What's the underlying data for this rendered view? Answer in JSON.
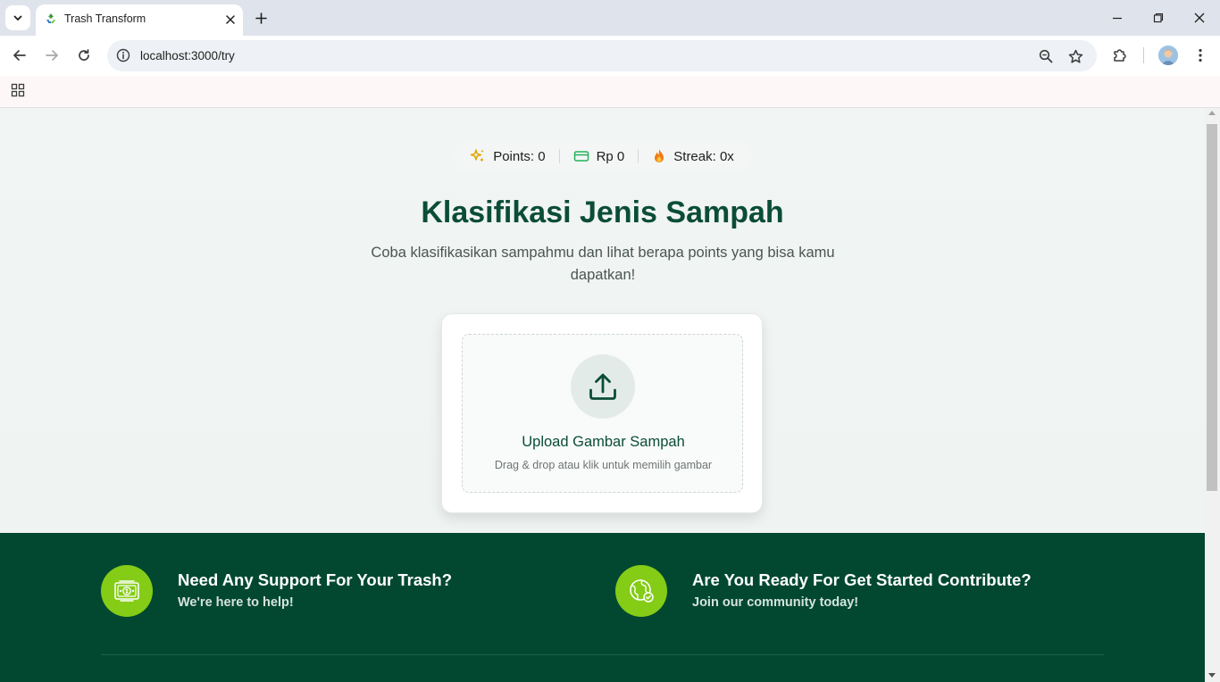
{
  "browser": {
    "tab_title": "Trash Transform",
    "url": "localhost:3000/try"
  },
  "stats": {
    "points": "Points: 0",
    "money": "Rp 0",
    "streak": "Streak: 0x"
  },
  "hero": {
    "title": "Klasifikasi Jenis Sampah",
    "subtitle": "Coba klasifikasikan sampahmu dan lihat berapa points yang bisa kamu dapatkan!"
  },
  "upload": {
    "label": "Upload Gambar Sampah",
    "hint": "Drag & drop atau klik untuk memilih gambar"
  },
  "footer": {
    "support_title": "Need Any Support For Your Trash?",
    "support_sub": "We're here to help!",
    "contribute_title": "Are You Ready For Get Started Contribute?",
    "contribute_sub": "Join our community today!"
  },
  "colors": {
    "brand_dark": "#024831",
    "heading": "#0b4d36",
    "accent": "#84cc16"
  }
}
